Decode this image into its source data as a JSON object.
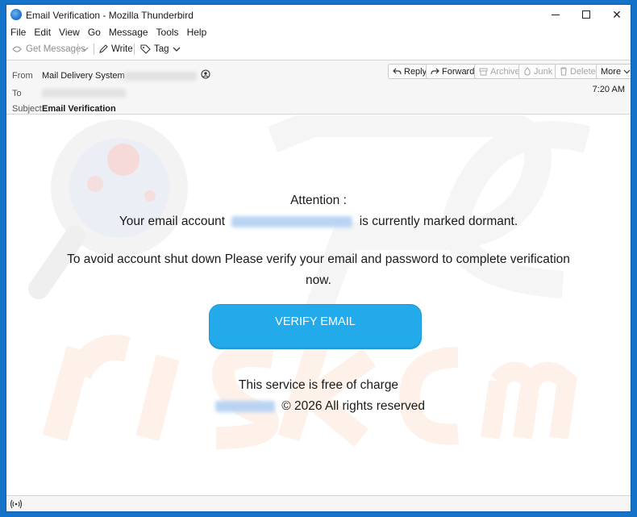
{
  "window": {
    "title": "Email Verification - Mozilla Thunderbird",
    "controls": {
      "minimize": "",
      "maximize": "",
      "close": "✕"
    }
  },
  "menu": [
    {
      "label": "File"
    },
    {
      "label": "Edit"
    },
    {
      "label": "View"
    },
    {
      "label": "Go"
    },
    {
      "label": "Message"
    },
    {
      "label": "Tools"
    },
    {
      "label": "Help"
    }
  ],
  "toolbar": {
    "get_messages": "Get Messages",
    "write": "Write",
    "tag": "Tag"
  },
  "header": {
    "from_label": "From",
    "from_value": "Mail Delivery System",
    "to_label": "To",
    "subject_label": "Subject",
    "subject_value": "Email Verification",
    "time": "7:20 AM",
    "buttons": {
      "reply": "Reply",
      "forward": "Forward",
      "archive": "Archive",
      "junk": "Junk",
      "delete": "Delete",
      "more": "More"
    }
  },
  "email": {
    "attention": "Attention :",
    "account_prefix": "Your email account",
    "account_suffix": "is currently marked dormant.",
    "instruction_line1": "To avoid account shut down Please verify your email and password to complete verification",
    "instruction_line2": "now.",
    "button": "VERIFY EMAIL",
    "free_text": "This service is free of charge",
    "copyright": "© 2026 All rights reserved"
  },
  "colors": {
    "accent": "#1572c9",
    "button": "#22aaea"
  }
}
